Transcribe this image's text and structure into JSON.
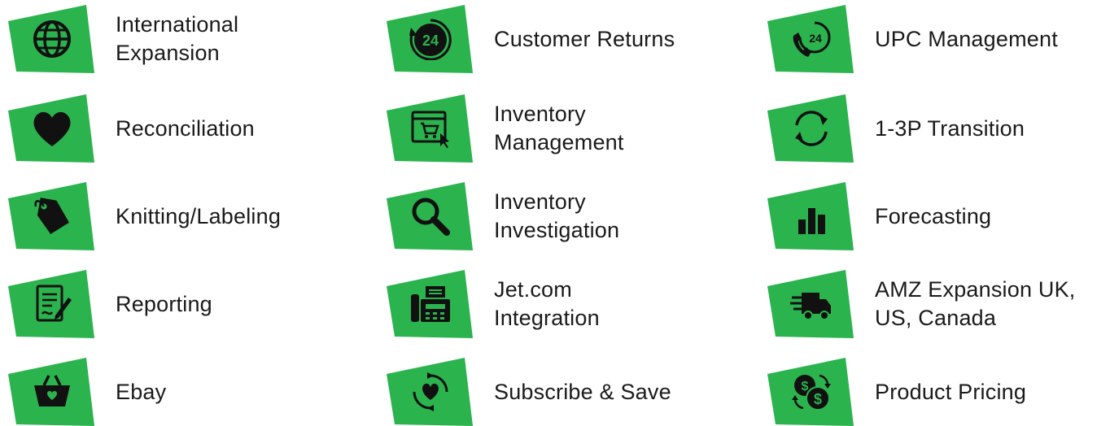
{
  "colors": {
    "accent": "#2bb34e",
    "icon": "#111111"
  },
  "columns": [
    {
      "items": [
        {
          "icon": "globe-icon",
          "label": "International\nExpansion"
        },
        {
          "icon": "heart-icon",
          "label": "Reconciliation"
        },
        {
          "icon": "price-tag-icon",
          "label": "Knitting/Labeling"
        },
        {
          "icon": "document-edit-icon",
          "label": "Reporting"
        },
        {
          "icon": "shopping-basket-icon",
          "label": "Ebay"
        }
      ]
    },
    {
      "items": [
        {
          "icon": "24-hours-icon",
          "label": "Customer Returns"
        },
        {
          "icon": "web-cart-icon",
          "label": "Inventory\nManagement"
        },
        {
          "icon": "magnifier-icon",
          "label": "Inventory\nInvestigation"
        },
        {
          "icon": "fax-machine-icon",
          "label": "Jet.com\nIntegration"
        },
        {
          "icon": "heart-refresh-icon",
          "label": "Subscribe & Save"
        }
      ]
    },
    {
      "items": [
        {
          "icon": "phone-24-icon",
          "label": "UPC Management"
        },
        {
          "icon": "refresh-arrows-icon",
          "label": "1-3P Transition"
        },
        {
          "icon": "bar-chart-icon",
          "label": "Forecasting"
        },
        {
          "icon": "delivery-truck-icon",
          "label": "AMZ Expansion UK,\nUS, Canada"
        },
        {
          "icon": "coins-exchange-icon",
          "label": "Product Pricing"
        }
      ]
    }
  ]
}
